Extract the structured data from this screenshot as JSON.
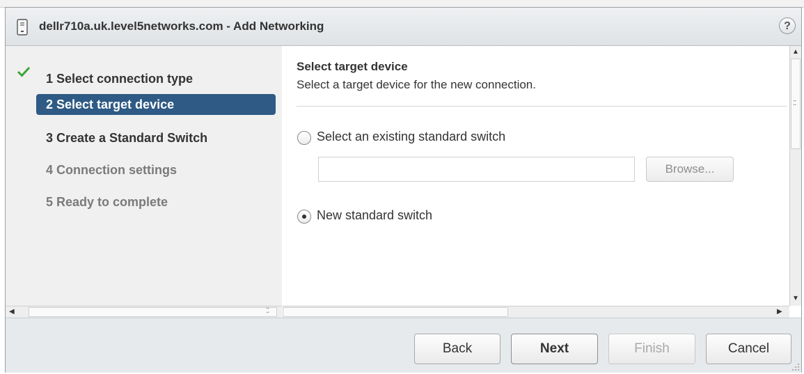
{
  "dialog": {
    "title": "dellr710a.uk.level5networks.com - Add Networking",
    "help_label": "?"
  },
  "steps": [
    {
      "label": "1  Select connection type",
      "state": "done"
    },
    {
      "label": "2  Select target device",
      "state": "active"
    },
    {
      "label": "3  Create a Standard Switch",
      "state": "next"
    },
    {
      "label": "4  Connection settings",
      "state": "pending"
    },
    {
      "label": "5  Ready to complete",
      "state": "pending"
    }
  ],
  "content": {
    "title": "Select target device",
    "subtitle": "Select a target device for the new connection.",
    "option_existing": {
      "label": "Select an existing standard switch",
      "selected": false,
      "input_value": "",
      "browse_label": "Browse..."
    },
    "option_new": {
      "label": "New standard switch",
      "selected": true
    }
  },
  "footer": {
    "back_label": "Back",
    "next_label": "Next",
    "finish_label": "Finish",
    "cancel_label": "Cancel"
  },
  "colors": {
    "active_step_bg": "#2e5a85",
    "check_green": "#3aa635"
  }
}
